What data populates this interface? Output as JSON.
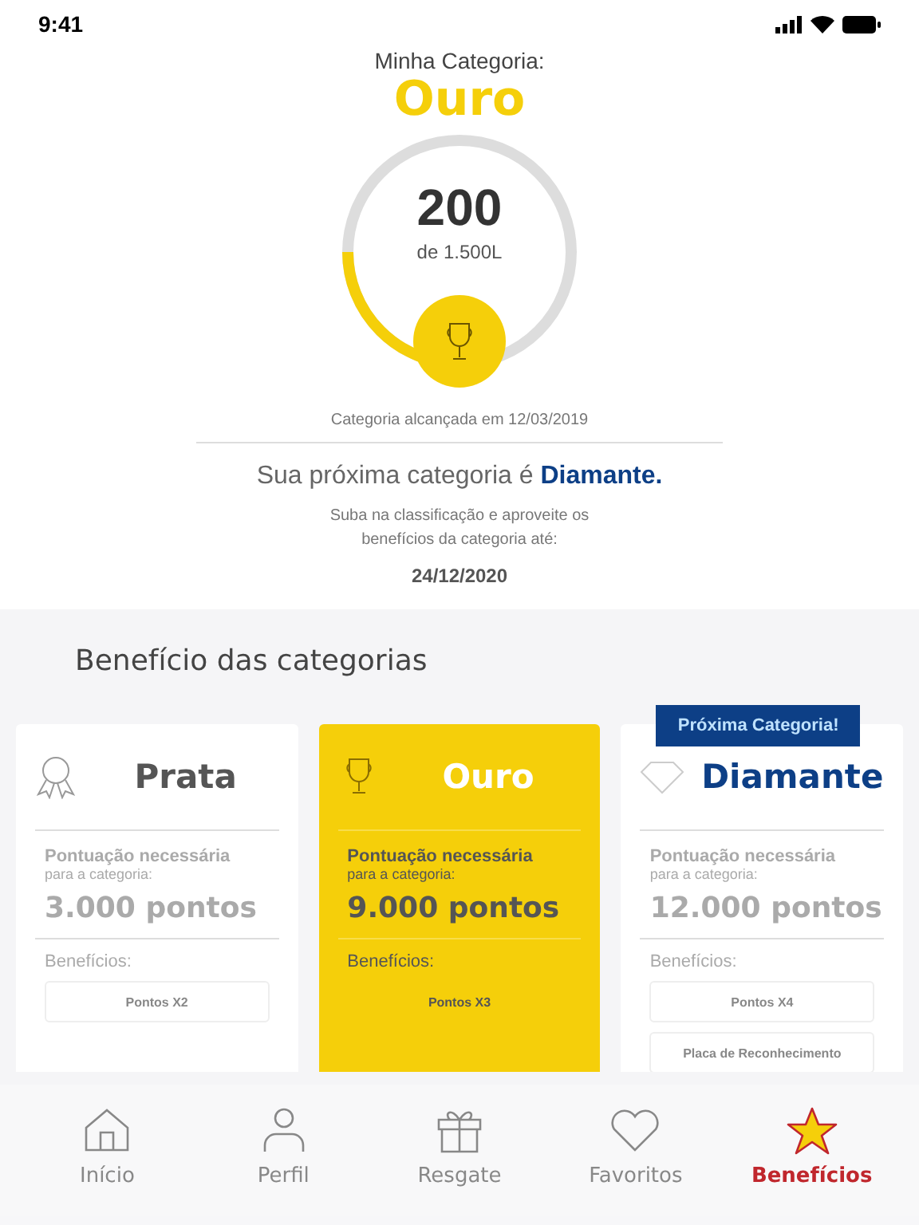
{
  "status_bar": {
    "time": "9:41"
  },
  "category": {
    "label": "Minha Categoria:",
    "name": "Ouro",
    "points": "200",
    "goal": "de 1.500L",
    "level": 0.25,
    "reached": "Categoria alcançada em 12/03/2019"
  },
  "next": {
    "text": "Sua próxima categoria é **Diamante.**",
    "subtitle": "Suba na classificação e aproveite os benefícios da categoria até:",
    "date": "24/12/2020"
  },
  "benefits": {
    "title": "Benefício das categorias",
    "cards": [
      {
        "kind": "silver",
        "name": "Prata",
        "highlighted": false,
        "requirement": "Pontuação necessária",
        "requirement_sub": "para a categoria:",
        "points": "3.000 pontos",
        "benefits_label": "Benefícios:",
        "items": [
          "Pontos X2"
        ]
      },
      {
        "kind": "gold",
        "name": "Ouro",
        "highlighted": true,
        "requirement": "Pontuação necessária",
        "requirement_sub": "para a categoria:",
        "points": "9.000 pontos",
        "benefits_label": "Benefícios:",
        "items": [
          "Pontos X3"
        ]
      },
      {
        "kind": "diamond",
        "name": "Diamante",
        "highlighted": false,
        "badge": "Próxima Categoria!",
        "requirement": "Pontuação necessária",
        "requirement_sub": "para a categoria:",
        "points": "12.000 pontos",
        "benefits_label": "Benefícios:",
        "items": [
          "Pontos X4",
          "Placa de Reconhecimento"
        ]
      }
    ]
  },
  "tabs": [
    {
      "kind": "home",
      "label": "Início",
      "selected": false
    },
    {
      "kind": "profile",
      "label": "Perfil",
      "selected": false
    },
    {
      "kind": "gift",
      "label": "Resgate",
      "selected": false
    },
    {
      "kind": "heart",
      "label": "Favoritos",
      "selected": false
    },
    {
      "kind": "star",
      "label": "Benefícios",
      "selected": true
    }
  ]
}
